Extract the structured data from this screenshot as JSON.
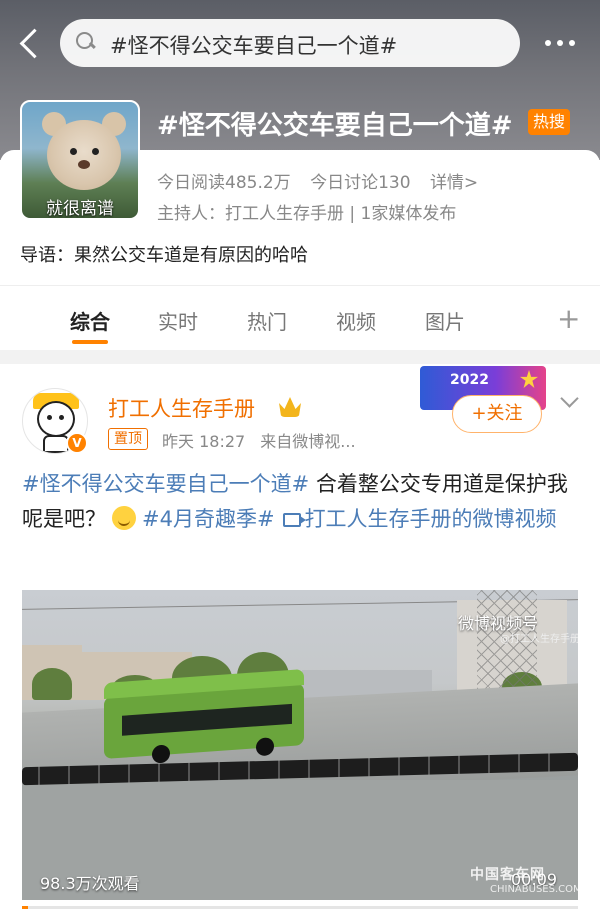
{
  "search": {
    "query": "#怪不得公交车要自己一个道#"
  },
  "topic": {
    "title": "#怪不得公交车要自己一个道#",
    "hot_badge": "热搜",
    "avatar_caption": "就很离谱",
    "reads": "今日阅读485.2万",
    "discussions": "今日讨论130",
    "details": "详情>",
    "host": "主持人：打工人生存手册 | 1家媒体发布",
    "intro": "导语：果然公交车道是有原因的哈哈"
  },
  "tabs": [
    {
      "label": "综合",
      "active": true
    },
    {
      "label": "实时",
      "active": false
    },
    {
      "label": "热门",
      "active": false
    },
    {
      "label": "视频",
      "active": false
    },
    {
      "label": "图片",
      "active": false
    }
  ],
  "tab_plus": "+",
  "post": {
    "author": "打工人生存手册",
    "pinned": "置顶",
    "time": "昨天 18:27",
    "source": "来自微博视...",
    "follow": "+关注",
    "promo_year": "2022",
    "text_hashtag1": "#怪不得公交车要自己一个道#",
    "text_body": " 合着整公交专用道是保护我呢是吧？",
    "text_hashtag2": "#4月奇趣季#",
    "text_link": "打工人生存手册的微博视频"
  },
  "video": {
    "watermark": "微博视频号",
    "watermark_sub": "@打工人生存手册",
    "views": "98.3万次观看",
    "duration": "00:09",
    "progress": 0.01
  },
  "site_watermark": "中国客车网",
  "site_watermark_sub": "CHINABUSES.COM",
  "colors": {
    "accent": "#ff8200",
    "link": "#4c7db7",
    "author": "#f06f00"
  }
}
